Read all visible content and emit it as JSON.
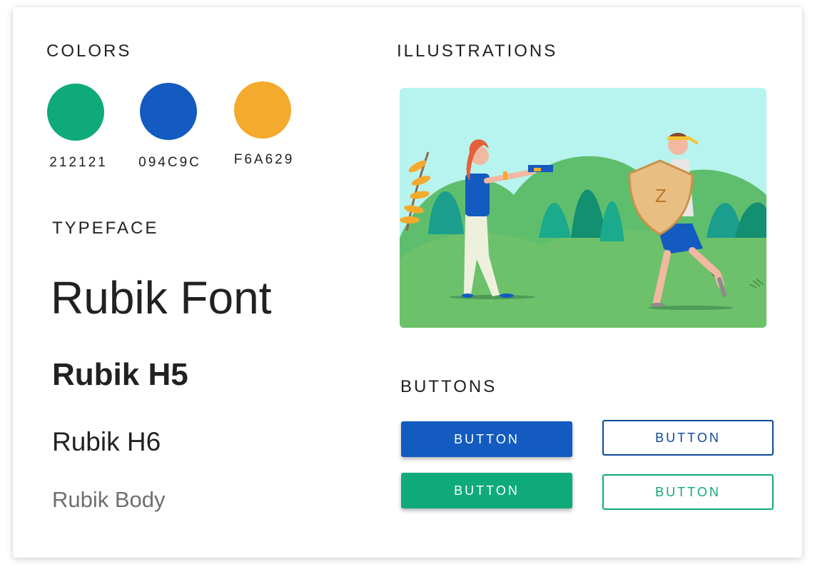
{
  "colors": {
    "title": "COLORS",
    "swatches": [
      {
        "label": "212121",
        "hex": "#0FAA7A"
      },
      {
        "label": "094C9C",
        "hex": "#135BC0"
      },
      {
        "label": "F6A629",
        "hex": "#F4AA2D"
      }
    ]
  },
  "typeface": {
    "title": "TYPEFACE",
    "display": "Rubik Font",
    "h5": "Rubik H5",
    "h6": "Rubik H6",
    "body": "Rubik Body"
  },
  "illustrations": {
    "title": "ILLUSTRATIONS",
    "shield_letter": "Z"
  },
  "buttons": {
    "title": "BUTTONS",
    "primary_filled": "BUTTON",
    "primary_outline": "BUTTON",
    "secondary_filled": "BUTTON",
    "secondary_outline": "BUTTON",
    "primary_color": "#135BC0",
    "primary_outline_color": "#0C4A97",
    "secondary_color": "#0FAA7A"
  }
}
